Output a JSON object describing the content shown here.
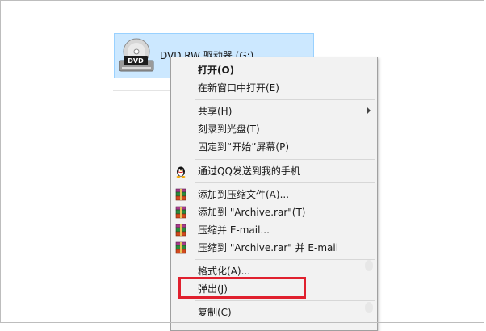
{
  "drive": {
    "label": "DVD RW 驱动器 (G:)",
    "icon_badge": "DVD",
    "icon": "dvd-drive-icon"
  },
  "menu": {
    "items": [
      {
        "label": "打开(O)",
        "bold": true
      },
      {
        "label": "在新窗口中打开(E)"
      },
      {
        "label": "共享(H)",
        "submenu": true
      },
      {
        "label": "刻录到光盘(T)"
      },
      {
        "label": "固定到“开始”屏幕(P)"
      },
      {
        "label": "通过QQ发送到我的手机",
        "icon": "qq-penguin-icon"
      },
      {
        "label": "添加到压缩文件(A)...",
        "icon": "winrar-icon"
      },
      {
        "label": "添加到 \"Archive.rar\"(T)",
        "icon": "winrar-icon"
      },
      {
        "label": "压缩并 E-mail...",
        "icon": "winrar-icon"
      },
      {
        "label": "压缩到 \"Archive.rar\" 并 E-mail",
        "icon": "winrar-icon"
      },
      {
        "label": "格式化(A)..."
      },
      {
        "label": "弹出(J)",
        "highlighted": true
      },
      {
        "label": "复制(C)"
      }
    ]
  },
  "colors": {
    "selection_bg": "#cce8ff",
    "selection_border": "#99d1ff",
    "menu_bg": "#f2f2f2",
    "highlight_box": "#e0202e"
  }
}
